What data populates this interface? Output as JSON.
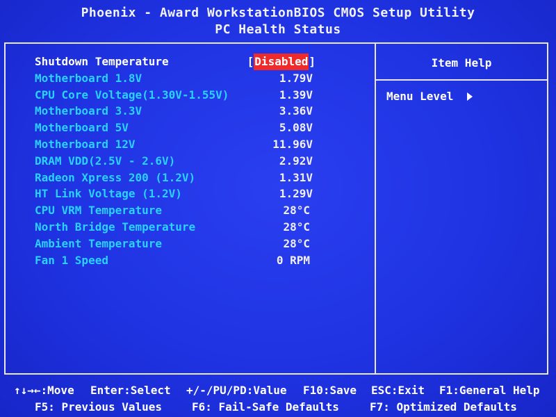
{
  "header": {
    "title": "Phoenix - Award WorkstationBIOS CMOS Setup Utility",
    "subtitle": "PC Health Status"
  },
  "settings": [
    {
      "label": "Shutdown Temperature",
      "value": "Disabled",
      "type": "option",
      "selected": true
    },
    {
      "label": "Motherboard 1.8V",
      "value": "1.79V",
      "type": "voltage"
    },
    {
      "label": "CPU Core Voltage(1.30V-1.55V)",
      "value": "1.39V",
      "type": "voltage"
    },
    {
      "label": "Motherboard 3.3V",
      "value": "3.36V",
      "type": "voltage"
    },
    {
      "label": "Motherboard 5V",
      "value": "5.08V",
      "type": "voltage"
    },
    {
      "label": "Motherboard 12V",
      "value": "11.96V",
      "type": "voltage"
    },
    {
      "label": "DRAM VDD(2.5V - 2.6V)",
      "value": "2.92V",
      "type": "voltage"
    },
    {
      "label": "Radeon Xpress 200 (1.2V)",
      "value": "1.31V",
      "type": "voltage"
    },
    {
      "label": "HT Link Voltage (1.2V)",
      "value": "1.29V",
      "type": "voltage"
    },
    {
      "label": "CPU VRM Temperature",
      "value": "28°C",
      "type": "temp"
    },
    {
      "label": "North Bridge Temperature",
      "value": "28°C",
      "type": "temp"
    },
    {
      "label": "Ambient Temperature",
      "value": "28°C",
      "type": "temp"
    },
    {
      "label": "Fan 1 Speed",
      "value": "0 RPM",
      "type": "rpm"
    }
  ],
  "option_brackets": {
    "open": "[",
    "close": "]"
  },
  "help_panel": {
    "title": "Item Help",
    "menu_level_label": "Menu Level",
    "menu_level_icon": "right-triangle-icon"
  },
  "footer": {
    "line1": [
      {
        "name": "move-hint",
        "text": "↑↓→←:Move"
      },
      {
        "name": "enter-select-hint",
        "text": "Enter:Select"
      },
      {
        "name": "value-hint",
        "text": "+/-/PU/PD:Value"
      },
      {
        "name": "save-hint",
        "text": "F10:Save"
      },
      {
        "name": "exit-hint",
        "text": "ESC:Exit"
      },
      {
        "name": "general-help-hint",
        "text": "F1:General Help"
      }
    ],
    "line2": [
      {
        "name": "previous-values-hint",
        "text": "F5: Previous Values"
      },
      {
        "name": "fail-safe-defaults-hint",
        "text": "F6: Fail-Safe Defaults"
      },
      {
        "name": "optimized-defaults-hint",
        "text": "F7: Optimized Defaults"
      }
    ]
  },
  "colors": {
    "background": "#1f33e2",
    "label_text": "#2ad2ff",
    "value_text": "#f0f0f0",
    "highlight": "#ee2a2a",
    "border": "#e8e8ee"
  }
}
